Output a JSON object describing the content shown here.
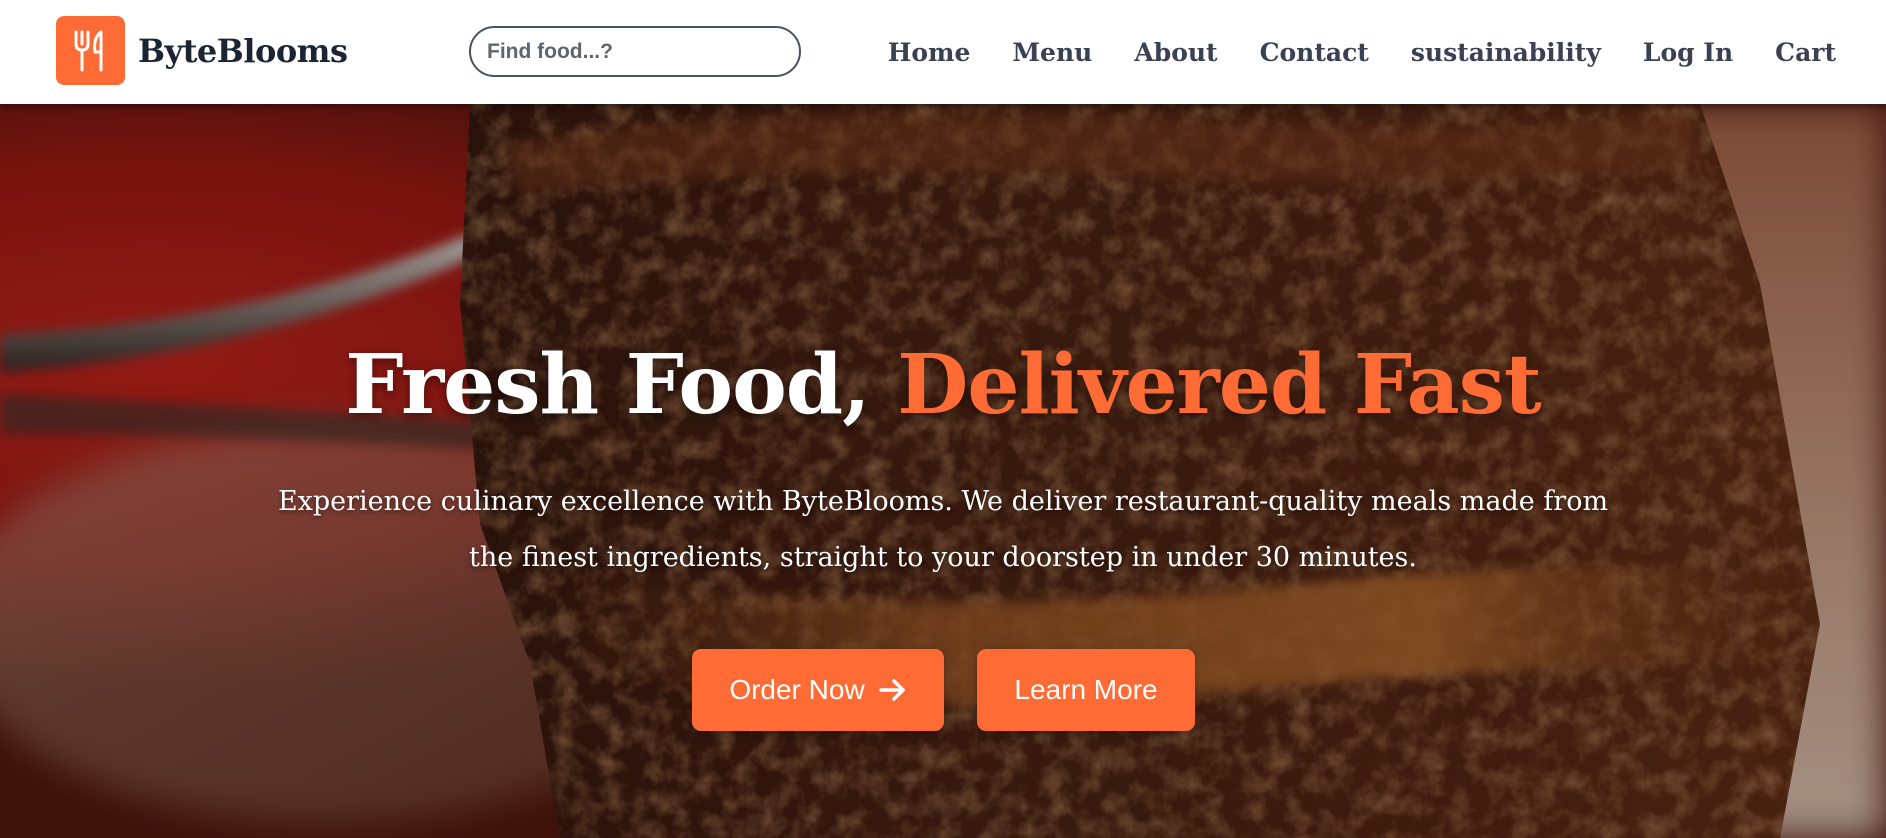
{
  "brand": {
    "name": "ByteBlooms",
    "logo_icon": "utensils-icon",
    "accent_color": "#ff6b35"
  },
  "search": {
    "placeholder": "Find food...?",
    "value": ""
  },
  "nav": {
    "items": [
      {
        "label": "Home"
      },
      {
        "label": "Menu"
      },
      {
        "label": "About"
      },
      {
        "label": "Contact"
      },
      {
        "label": "sustainability"
      },
      {
        "label": "Log In"
      },
      {
        "label": "Cart"
      }
    ]
  },
  "hero": {
    "title_main": "Fresh Food,",
    "title_accent": "Delivered Fast",
    "subtitle": "Experience culinary excellence with ByteBlooms. We deliver restaurant-quality meals made from the finest ingredients, straight to your doorstep in under 30 minutes.",
    "primary_button": {
      "label": "Order Now",
      "icon": "arrow-right-icon"
    },
    "secondary_button": {
      "label": "Learn More"
    },
    "background": "chocolate-cake-on-fork-photo",
    "colors": {
      "accent": "#ff6b35",
      "text": "#ffffff"
    }
  }
}
